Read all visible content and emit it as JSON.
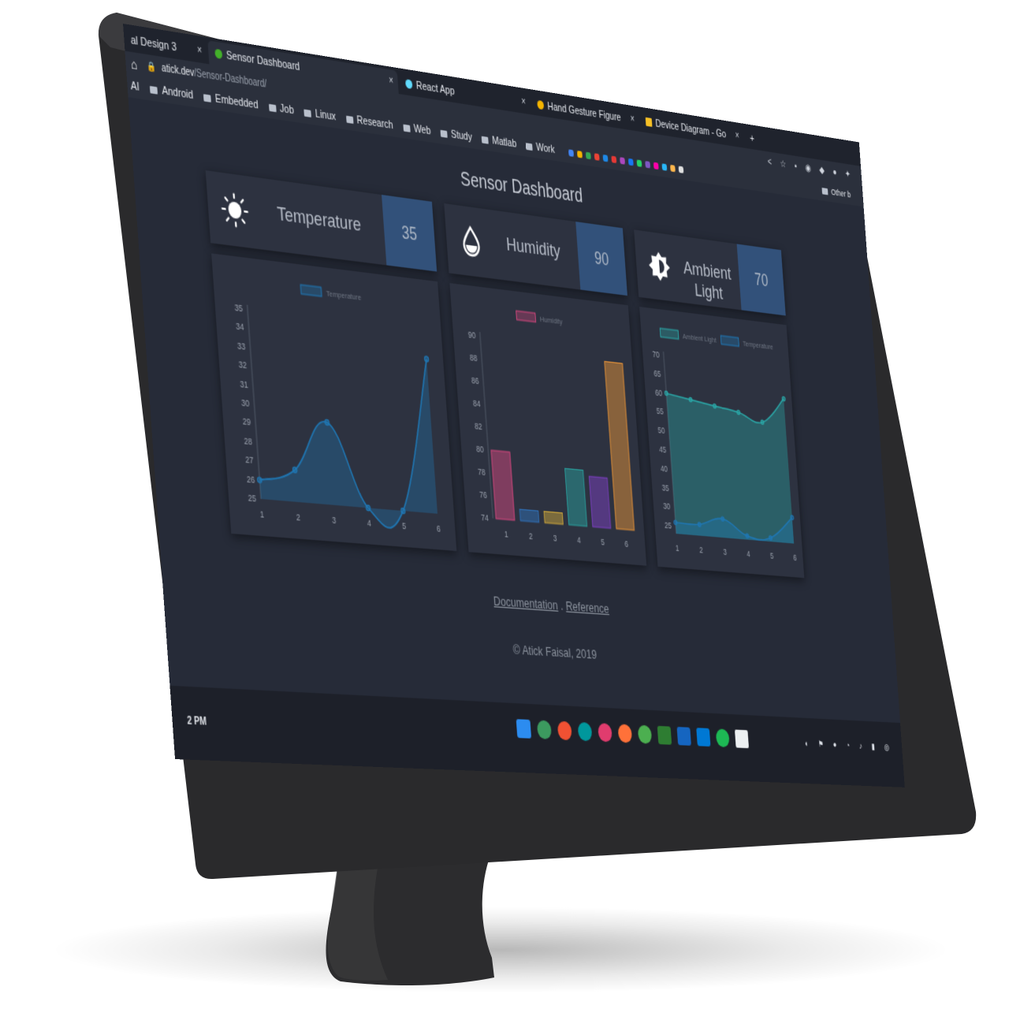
{
  "browser": {
    "tabs": [
      {
        "label": "al Design 3",
        "active": false
      },
      {
        "label": "Sensor Dashboard",
        "active": true
      },
      {
        "label": "React App",
        "active": false
      },
      {
        "label": "Hand Gesture Figure",
        "active": false
      },
      {
        "label": "Device Diagram - Go",
        "active": false
      }
    ],
    "tab_close": "×",
    "new_tab": "+",
    "url_host": "atick.dev",
    "url_path": "/Sensor-Dashboard/",
    "bookmarks": [
      "AI",
      "Android",
      "Embedded",
      "Job",
      "Linux",
      "Research",
      "Web",
      "Study",
      "Matlab",
      "Work"
    ],
    "bookmark_other": "Other b"
  },
  "dashboard": {
    "title": "Sensor Dashboard",
    "sensors": [
      {
        "label": "Temperature",
        "value": "35",
        "icon": "sun-icon"
      },
      {
        "label": "Humidity",
        "value": "90",
        "icon": "water-drop-icon"
      },
      {
        "label": "Ambient Light",
        "value": "70",
        "icon": "brightness-icon"
      }
    ],
    "footer": {
      "doc_link": "Documentation",
      "separator": ".",
      "ref_link": "Reference",
      "copyright": "© Atick Faisal, 2019"
    }
  },
  "chart_data": [
    {
      "type": "area",
      "legend": [
        "Temperature"
      ],
      "x": [
        1,
        2,
        3,
        4,
        5,
        6
      ],
      "series": [
        {
          "name": "Temperature",
          "values": [
            26,
            26.7,
            29.4,
            25,
            25,
            33.4
          ],
          "color": "#1f77b4"
        }
      ],
      "yticks": [
        25,
        26,
        27,
        28,
        29,
        30,
        31,
        32,
        33,
        34,
        35
      ],
      "ylim": [
        25,
        35
      ]
    },
    {
      "type": "bar",
      "legend": [
        "Humidity"
      ],
      "categories": [
        "1",
        "2",
        "3",
        "4",
        "5",
        "6"
      ],
      "values": [
        80,
        75,
        75,
        79,
        78.5,
        89
      ],
      "colors": [
        "#d1477d",
        "#2f6fb5",
        "#c9a33a",
        "#2a9d9b",
        "#7b3fbf",
        "#e39138"
      ],
      "yticks": [
        74,
        76,
        78,
        80,
        82,
        84,
        86,
        88,
        90
      ],
      "ylim": [
        74,
        90
      ]
    },
    {
      "type": "area",
      "legend": [
        "Ambient Light",
        "Temperature"
      ],
      "x": [
        1,
        2,
        3,
        4,
        5,
        6
      ],
      "series": [
        {
          "name": "Ambient Light",
          "values": [
            60,
            59,
            58,
            57,
            55,
            62
          ],
          "color": "#2aa8a8"
        },
        {
          "name": "Temperature",
          "values": [
            26,
            26,
            28,
            24,
            24,
            30
          ],
          "color": "#1f77b4"
        }
      ],
      "yticks": [
        25,
        30,
        35,
        40,
        45,
        50,
        55,
        60,
        65,
        70
      ],
      "ylim": [
        23,
        70
      ]
    }
  ],
  "taskbar": {
    "clock": "2 PM"
  },
  "colors": {
    "page_bg": "#262b38",
    "card_bg": "#2d3240",
    "value_box": "#32517a",
    "monitor_bezel": "#2a2a2c"
  }
}
